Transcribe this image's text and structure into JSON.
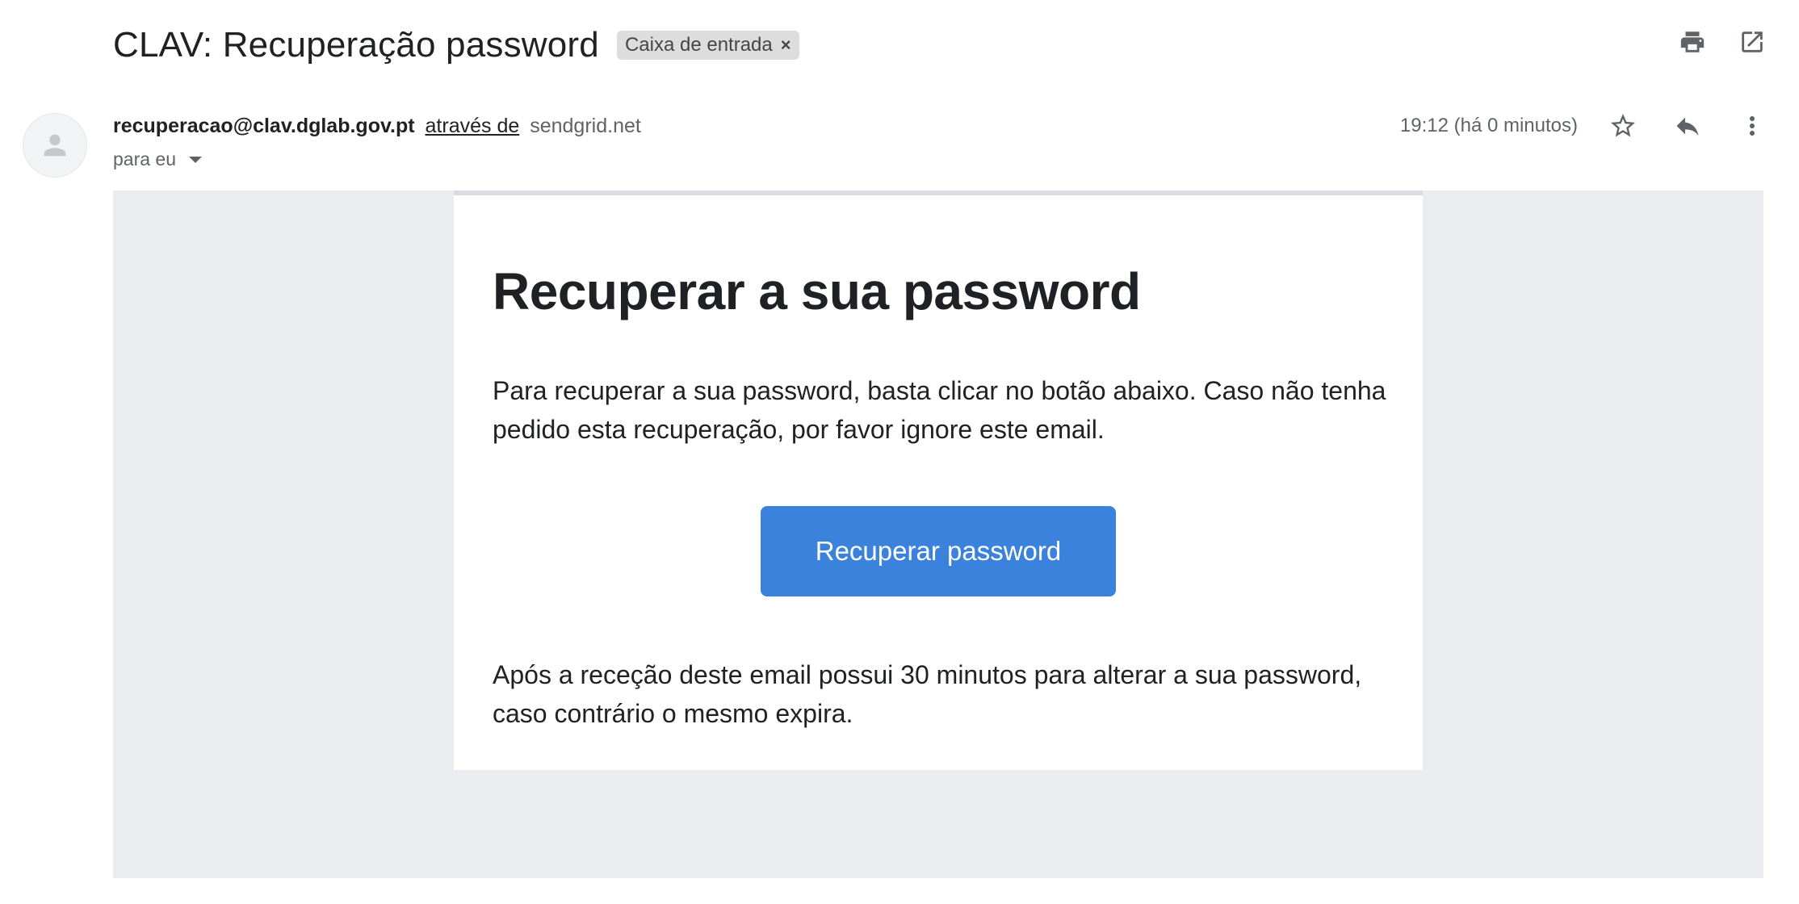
{
  "header": {
    "subject": "CLAV: Recuperação password",
    "label": "Caixa de entrada",
    "label_remove_glyph": "×",
    "actions": [
      "print-icon",
      "open-in-new-window-icon"
    ]
  },
  "sender": {
    "email": "recuperacao@clav.dglab.gov.pt",
    "via_text": "através de",
    "via_domain": "sendgrid.net",
    "to_text": "para eu",
    "timestamp": "19:12 (há 0 minutos)",
    "actions": [
      "star-icon",
      "reply-icon",
      "more-options-icon"
    ]
  },
  "email_body": {
    "heading": "Recuperar a sua password",
    "paragraph1": "Para recuperar a sua password, basta clicar no botão abaixo. Caso não tenha pedido esta recuperação, por favor ignore este email.",
    "button_label": "Recuperar password",
    "button_color": "#3b82dd",
    "paragraph2": "Após a receção deste email possui 30 minutos para alterar a sua password, caso contrário o mesmo expira."
  },
  "colors": {
    "body_background": "#eaecf0",
    "text_primary": "#202124",
    "text_secondary": "#5f6368"
  }
}
